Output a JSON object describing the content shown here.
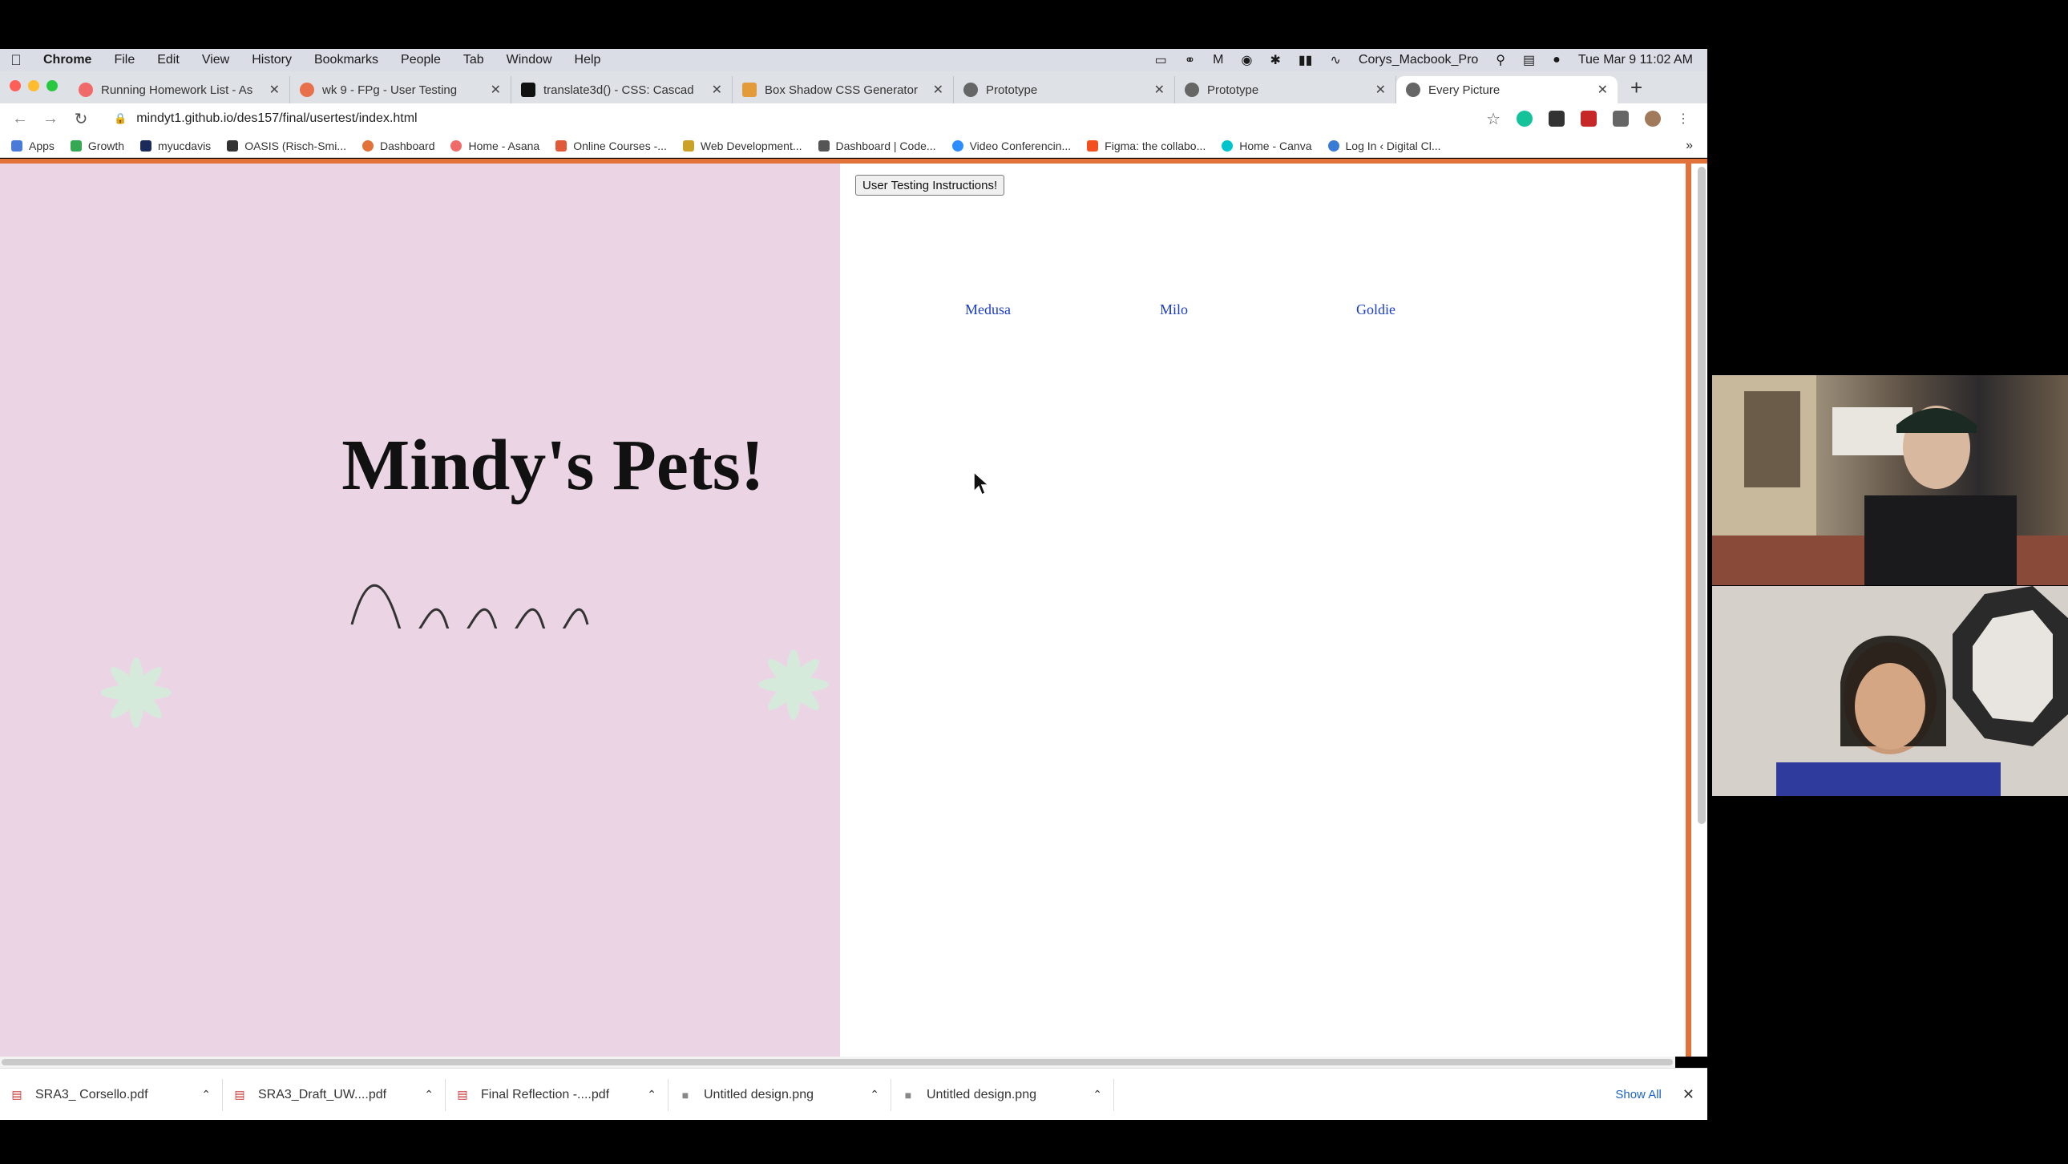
{
  "menubar": {
    "app": "Chrome",
    "items": [
      "File",
      "Edit",
      "View",
      "History",
      "Bookmarks",
      "People",
      "Tab",
      "Window",
      "Help"
    ],
    "computer_name": "Corys_Macbook_Pro",
    "datetime": "Tue Mar 9  11:02 AM"
  },
  "tabs": [
    {
      "title": "Running Homework List - As",
      "favicon_color": "#f06a6a"
    },
    {
      "title": "wk 9 - FPg - User Testing",
      "favicon_color": "#e8704a"
    },
    {
      "title": "translate3d() - CSS: Cascad",
      "favicon_color": "#111111"
    },
    {
      "title": "Box Shadow CSS Generator",
      "favicon_color": "#e39b3a"
    },
    {
      "title": "Prototype",
      "favicon_color": "#666666"
    },
    {
      "title": "Prototype",
      "favicon_color": "#666666"
    },
    {
      "title": "Every Picture",
      "favicon_color": "#666666",
      "active": true
    }
  ],
  "address": {
    "url": "mindyt1.github.io/des157/final/usertest/index.html"
  },
  "bookmarks": [
    {
      "label": "Apps",
      "color": "#4a7bd8"
    },
    {
      "label": "Growth",
      "color": "#34a853"
    },
    {
      "label": "myucdavis",
      "color": "#1a2a5a"
    },
    {
      "label": "OASIS (Risch-Smi...",
      "color": "#333333"
    },
    {
      "label": "Dashboard",
      "color": "#e0723a"
    },
    {
      "label": "Home - Asana",
      "color": "#f06a6a"
    },
    {
      "label": "Online Courses -...",
      "color": "#e05a3a"
    },
    {
      "label": "Web Development...",
      "color": "#c9a227"
    },
    {
      "label": "Dashboard | Code...",
      "color": "#555555"
    },
    {
      "label": "Video Conferencin...",
      "color": "#2d8cff"
    },
    {
      "label": "Figma: the collabo...",
      "color": "#f24e1e"
    },
    {
      "label": "Home - Canva",
      "color": "#00c4cc"
    },
    {
      "label": "Log In ‹ Digital Cl...",
      "color": "#3a7bd5"
    }
  ],
  "page": {
    "instructions_button": "User Testing Instructions!",
    "title": "Mindy's Pets!",
    "pets": [
      "Medusa",
      "Milo",
      "Goldie"
    ]
  },
  "downloads": {
    "files": [
      "SRA3_ Corsello.pdf",
      "SRA3_Draft_UW....pdf",
      "Final Reflection -....pdf",
      "Untitled design.png",
      "Untitled design.png"
    ],
    "show_all": "Show All"
  },
  "colors": {
    "accent_orange": "#e0723a",
    "left_pane_pink": "#ebd5e4",
    "link_blue": "#1a3cc8"
  }
}
